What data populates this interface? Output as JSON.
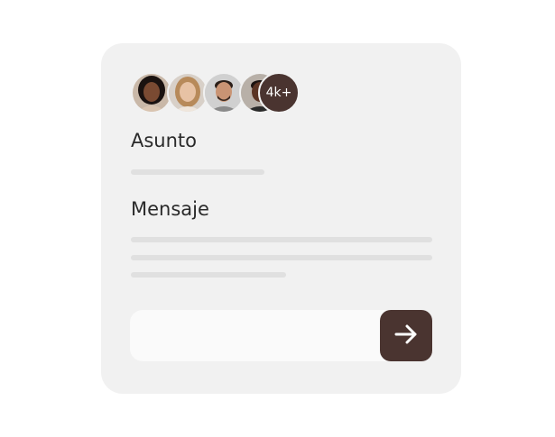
{
  "colors": {
    "card_bg": "#f1f1f1",
    "accent": "#4a3430",
    "placeholder_line": "#e0e0e0",
    "input_bg": "#fafafa",
    "text": "#2a2a2a"
  },
  "avatars": {
    "people": [
      {
        "name": "avatar-1",
        "skin": "#7a4a32",
        "hair": "#1a1210",
        "bg": "#c9b8a8"
      },
      {
        "name": "avatar-2",
        "skin": "#e7c2a4",
        "hair": "#b78a5a",
        "bg": "#d8d0c8"
      },
      {
        "name": "avatar-3",
        "skin": "#c99474",
        "hair": "#2a1e18",
        "bg": "#d0d0d0"
      },
      {
        "name": "avatar-4",
        "skin": "#5a3424",
        "hair": "#1a1210",
        "bg": "#b8b0a8"
      }
    ],
    "count_label": "4k+"
  },
  "form": {
    "subject_label": "Asunto",
    "message_label": "Mensaje",
    "input_placeholder": "",
    "send_icon": "arrow-right-icon"
  }
}
